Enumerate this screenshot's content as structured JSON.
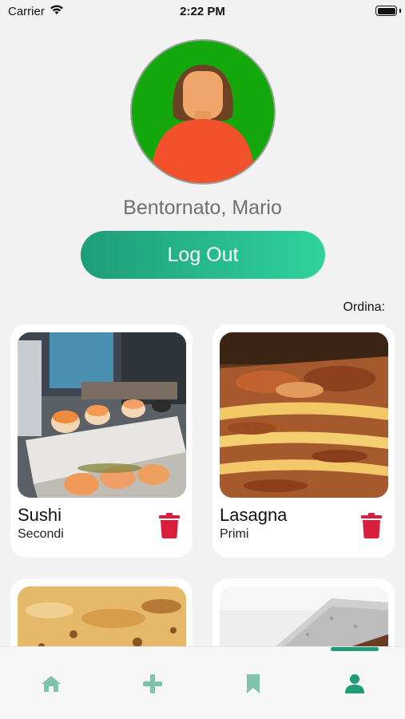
{
  "status_bar": {
    "carrier": "Carrier",
    "time": "2:22 PM"
  },
  "profile": {
    "greeting": "Bentornato, Mario",
    "logout_label": "Log Out"
  },
  "sort": {
    "label": "Ordina:"
  },
  "recipes": [
    {
      "name": "Sushi",
      "category": "Secondi"
    },
    {
      "name": "Lasagna",
      "category": "Primi"
    }
  ],
  "tab_bar": {
    "items": [
      {
        "icon": "home-icon"
      },
      {
        "icon": "plus-icon"
      },
      {
        "icon": "bookmark-icon"
      },
      {
        "icon": "person-icon",
        "selected": true
      }
    ]
  },
  "colors": {
    "accent": "#1e9c78",
    "accent_light": "#2fd39c",
    "avatar_bg": "#14a80d",
    "delete": "#d81e3c",
    "tab_icon": "#7fc3ad"
  }
}
